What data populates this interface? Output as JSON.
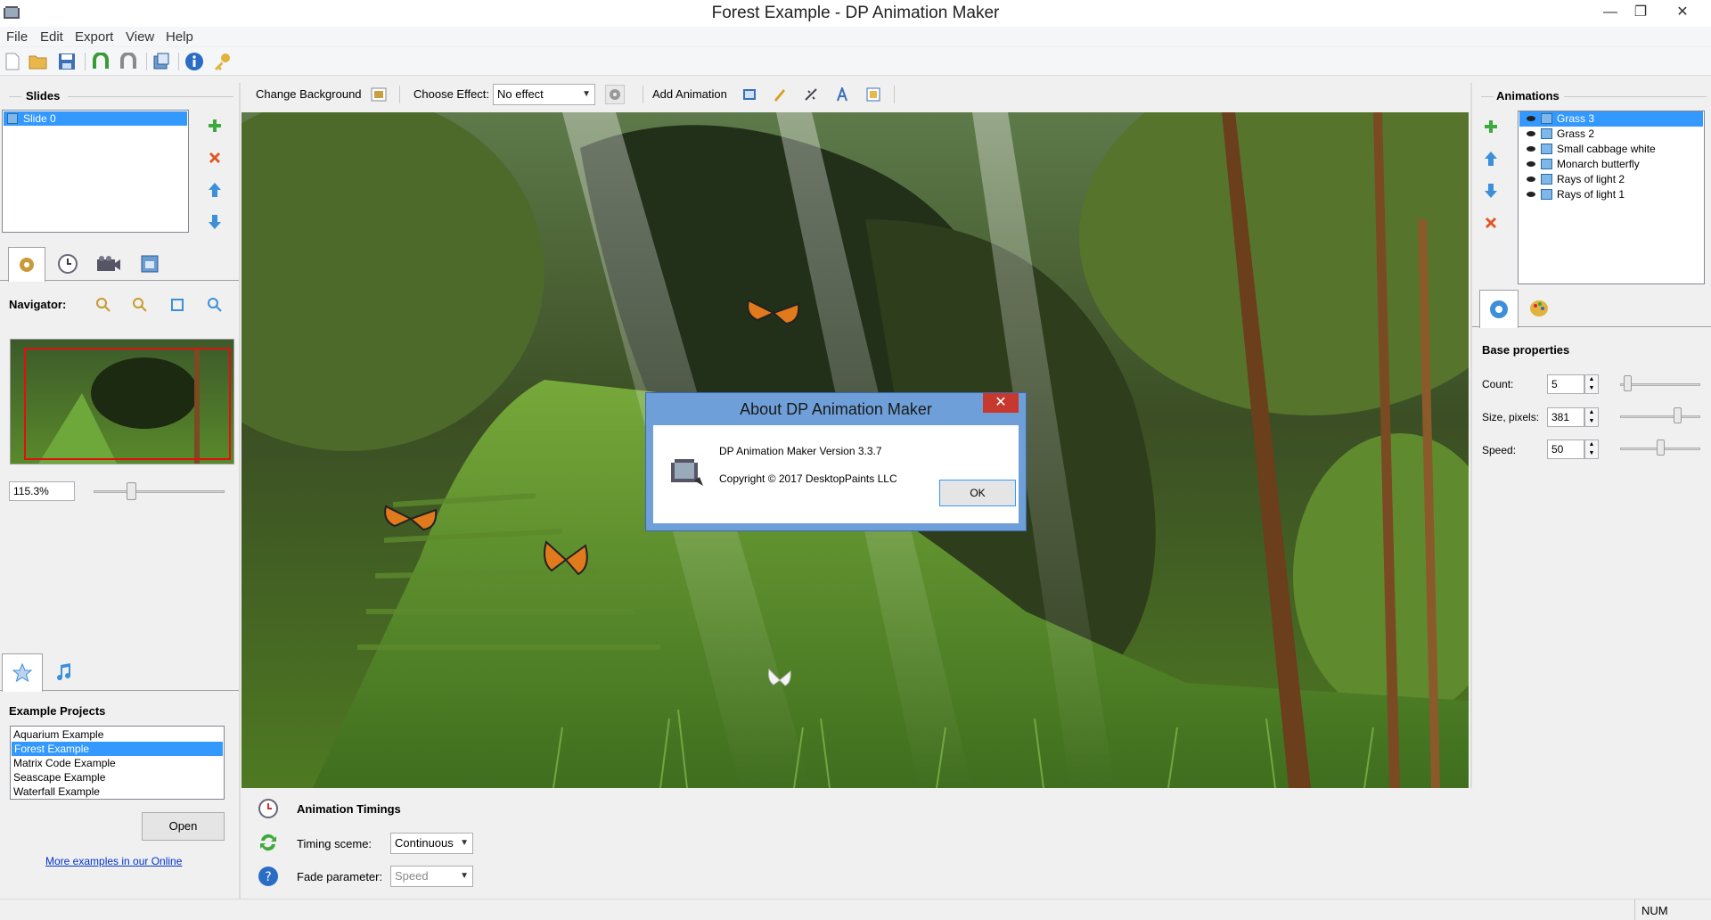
{
  "window": {
    "title": "Forest Example - DP Animation Maker",
    "minimize_glyph": "—",
    "maximize_glyph": "❐",
    "close_glyph": "✕"
  },
  "menu": {
    "items": [
      "File",
      "Edit",
      "Export",
      "View",
      "Help"
    ]
  },
  "toolbar": {
    "icons": [
      "new-file-icon",
      "open-folder-icon",
      "save-icon",
      "undo-icon",
      "redo-icon",
      "export-icon",
      "info-icon",
      "key-icon"
    ]
  },
  "slides_panel": {
    "title": "Slides",
    "items": [
      {
        "label": "Slide 0",
        "selected": true
      }
    ]
  },
  "navigator": {
    "label": "Navigator:",
    "zoom_value": "115.3%",
    "zoom_slider_fraction": 0.27
  },
  "canvas_toolbar": {
    "change_background": "Change Background",
    "choose_effect_label": "Choose Effect:",
    "effect_value": "No effect",
    "add_animation": "Add Animation"
  },
  "examples": {
    "title": "Example Projects",
    "items": [
      {
        "label": "Aquarium Example",
        "selected": false
      },
      {
        "label": "Forest Example",
        "selected": true
      },
      {
        "label": "Matrix Code Example",
        "selected": false
      },
      {
        "label": "Seascape Example",
        "selected": false
      },
      {
        "label": "Waterfall Example",
        "selected": false
      }
    ],
    "open_button": "Open",
    "more_link": "More examples in our Online"
  },
  "animations_panel": {
    "title": "Animations",
    "items": [
      {
        "label": "Grass 3",
        "selected": true
      },
      {
        "label": "Grass 2",
        "selected": false
      },
      {
        "label": "Small cabbage white",
        "selected": false
      },
      {
        "label": "Monarch butterfly",
        "selected": false
      },
      {
        "label": "Rays of light 2",
        "selected": false
      },
      {
        "label": "Rays of light 1",
        "selected": false
      }
    ]
  },
  "base_properties": {
    "title": "Base properties",
    "count_label": "Count:",
    "count_value": "5",
    "count_slider_fraction": 0.05,
    "size_label": "Size, pixels:",
    "size_value": "381",
    "size_slider_fraction": 0.74,
    "speed_label": "Speed:",
    "speed_value": "50",
    "speed_slider_fraction": 0.5
  },
  "timings": {
    "title": "Animation Timings",
    "timing_label": "Timing sceme:",
    "timing_value": "Continuous",
    "fade_label": "Fade parameter:",
    "fade_value": "Speed"
  },
  "dialog": {
    "title": "About DP Animation Maker",
    "version": "DP Animation Maker Version 3.3.7",
    "copyright": "Copyright © 2017 DesktopPaints LLC",
    "ok": "OK"
  },
  "status": {
    "num": "NUM"
  },
  "colors": {
    "selection": "#3399ff",
    "dialog_frame": "#6f9fd8",
    "close_red": "#c7392e",
    "link": "#0033cc"
  }
}
